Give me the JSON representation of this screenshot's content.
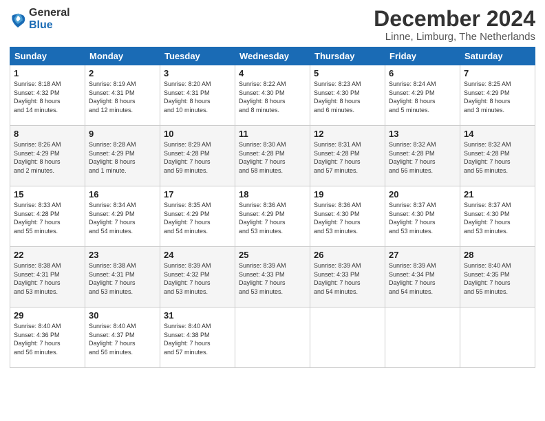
{
  "logo": {
    "general": "General",
    "blue": "Blue"
  },
  "title": {
    "month": "December 2024",
    "location": "Linne, Limburg, The Netherlands"
  },
  "headers": [
    "Sunday",
    "Monday",
    "Tuesday",
    "Wednesday",
    "Thursday",
    "Friday",
    "Saturday"
  ],
  "weeks": [
    [
      {
        "day": "1",
        "sunrise": "8:18 AM",
        "sunset": "4:32 PM",
        "daylight": "8 hours and 14 minutes."
      },
      {
        "day": "2",
        "sunrise": "8:19 AM",
        "sunset": "4:31 PM",
        "daylight": "8 hours and 12 minutes."
      },
      {
        "day": "3",
        "sunrise": "8:20 AM",
        "sunset": "4:31 PM",
        "daylight": "8 hours and 10 minutes."
      },
      {
        "day": "4",
        "sunrise": "8:22 AM",
        "sunset": "4:30 PM",
        "daylight": "8 hours and 8 minutes."
      },
      {
        "day": "5",
        "sunrise": "8:23 AM",
        "sunset": "4:30 PM",
        "daylight": "8 hours and 6 minutes."
      },
      {
        "day": "6",
        "sunrise": "8:24 AM",
        "sunset": "4:29 PM",
        "daylight": "8 hours and 5 minutes."
      },
      {
        "day": "7",
        "sunrise": "8:25 AM",
        "sunset": "4:29 PM",
        "daylight": "8 hours and 3 minutes."
      }
    ],
    [
      {
        "day": "8",
        "sunrise": "8:26 AM",
        "sunset": "4:29 PM",
        "daylight": "8 hours and 2 minutes."
      },
      {
        "day": "9",
        "sunrise": "8:28 AM",
        "sunset": "4:29 PM",
        "daylight": "8 hours and 1 minute."
      },
      {
        "day": "10",
        "sunrise": "8:29 AM",
        "sunset": "4:28 PM",
        "daylight": "7 hours and 59 minutes."
      },
      {
        "day": "11",
        "sunrise": "8:30 AM",
        "sunset": "4:28 PM",
        "daylight": "7 hours and 58 minutes."
      },
      {
        "day": "12",
        "sunrise": "8:31 AM",
        "sunset": "4:28 PM",
        "daylight": "7 hours and 57 minutes."
      },
      {
        "day": "13",
        "sunrise": "8:32 AM",
        "sunset": "4:28 PM",
        "daylight": "7 hours and 56 minutes."
      },
      {
        "day": "14",
        "sunrise": "8:32 AM",
        "sunset": "4:28 PM",
        "daylight": "7 hours and 55 minutes."
      }
    ],
    [
      {
        "day": "15",
        "sunrise": "8:33 AM",
        "sunset": "4:28 PM",
        "daylight": "7 hours and 55 minutes."
      },
      {
        "day": "16",
        "sunrise": "8:34 AM",
        "sunset": "4:29 PM",
        "daylight": "7 hours and 54 minutes."
      },
      {
        "day": "17",
        "sunrise": "8:35 AM",
        "sunset": "4:29 PM",
        "daylight": "7 hours and 54 minutes."
      },
      {
        "day": "18",
        "sunrise": "8:36 AM",
        "sunset": "4:29 PM",
        "daylight": "7 hours and 53 minutes."
      },
      {
        "day": "19",
        "sunrise": "8:36 AM",
        "sunset": "4:30 PM",
        "daylight": "7 hours and 53 minutes."
      },
      {
        "day": "20",
        "sunrise": "8:37 AM",
        "sunset": "4:30 PM",
        "daylight": "7 hours and 53 minutes."
      },
      {
        "day": "21",
        "sunrise": "8:37 AM",
        "sunset": "4:30 PM",
        "daylight": "7 hours and 53 minutes."
      }
    ],
    [
      {
        "day": "22",
        "sunrise": "8:38 AM",
        "sunset": "4:31 PM",
        "daylight": "7 hours and 53 minutes."
      },
      {
        "day": "23",
        "sunrise": "8:38 AM",
        "sunset": "4:31 PM",
        "daylight": "7 hours and 53 minutes."
      },
      {
        "day": "24",
        "sunrise": "8:39 AM",
        "sunset": "4:32 PM",
        "daylight": "7 hours and 53 minutes."
      },
      {
        "day": "25",
        "sunrise": "8:39 AM",
        "sunset": "4:33 PM",
        "daylight": "7 hours and 53 minutes."
      },
      {
        "day": "26",
        "sunrise": "8:39 AM",
        "sunset": "4:33 PM",
        "daylight": "7 hours and 54 minutes."
      },
      {
        "day": "27",
        "sunrise": "8:39 AM",
        "sunset": "4:34 PM",
        "daylight": "7 hours and 54 minutes."
      },
      {
        "day": "28",
        "sunrise": "8:40 AM",
        "sunset": "4:35 PM",
        "daylight": "7 hours and 55 minutes."
      }
    ],
    [
      {
        "day": "29",
        "sunrise": "8:40 AM",
        "sunset": "4:36 PM",
        "daylight": "7 hours and 56 minutes."
      },
      {
        "day": "30",
        "sunrise": "8:40 AM",
        "sunset": "4:37 PM",
        "daylight": "7 hours and 56 minutes."
      },
      {
        "day": "31",
        "sunrise": "8:40 AM",
        "sunset": "4:38 PM",
        "daylight": "7 hours and 57 minutes."
      },
      null,
      null,
      null,
      null
    ]
  ]
}
